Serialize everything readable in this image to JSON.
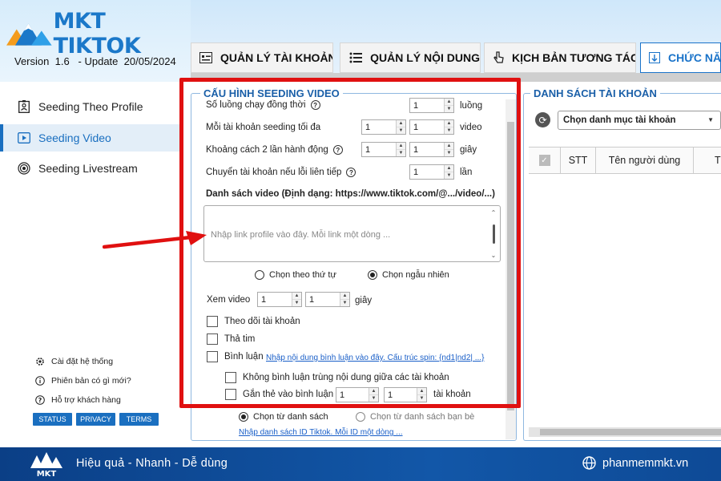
{
  "app": {
    "logo_text": "MKT TIKTOK",
    "version_label": "Version",
    "version": "1.6",
    "update_label": "- Update",
    "update_date": "20/05/2024"
  },
  "tabs": [
    {
      "label": "QUẢN LÝ TÀI KHOẢN",
      "icon": "account-list-icon"
    },
    {
      "label": "QUẢN LÝ NỘI DUNG",
      "icon": "content-list-icon"
    },
    {
      "label": "KỊCH BẢN TƯƠNG TÁC",
      "icon": "hand-pointer-icon"
    },
    {
      "label": "CHỨC NĂ",
      "icon": "function-icon",
      "active": true
    }
  ],
  "sidebar": {
    "items": [
      {
        "label": "Seeding Theo Profile",
        "icon": "profile-card-icon"
      },
      {
        "label": "Seeding Video",
        "icon": "video-icon",
        "active": true
      },
      {
        "label": "Seeding Livestream",
        "icon": "livestream-icon"
      }
    ],
    "footer_links": [
      {
        "label": "Cài đặt hệ thống",
        "icon": "gear-icon"
      },
      {
        "label": "Phiên bản có gì mới?",
        "icon": "info-icon"
      },
      {
        "label": "Hỗ trợ khách hàng",
        "icon": "help-icon"
      }
    ],
    "badges": [
      "STATUS",
      "PRIVACY",
      "TERMS"
    ]
  },
  "config": {
    "title": "CẤU HÌNH SEEDING VIDEO",
    "threads_label": "Số luồng chạy đồng thời",
    "threads_value": "1",
    "threads_unit": "luồng",
    "per_account_label": "Mỗi tài khoản seeding tối đa",
    "per_account_min": "1",
    "per_account_max": "1",
    "per_account_unit": "video",
    "interval_label": "Khoảng cách 2 lần hành động",
    "interval_min": "1",
    "interval_max": "1",
    "interval_unit": "giây",
    "switch_label": "Chuyển tài khoản nếu lỗi liên tiếp",
    "switch_value": "1",
    "switch_unit": "lần",
    "video_list_label": "Danh sách video (Định dạng: https://www.tiktok.com/@.../video/...)",
    "video_list_placeholder": "Nhập link profile vào đây. Mỗi link một dòng ...",
    "order_sequential": "Chọn theo thứ tự",
    "order_random": "Chọn ngẫu nhiên",
    "watch_label": "Xem video",
    "watch_min": "1",
    "watch_max": "1",
    "watch_unit": "giây",
    "follow_label": "Theo dõi tài khoản",
    "like_label": "Thả tim",
    "comment_label": "Bình luận",
    "comment_link": "Nhập nội dung bình luận vào đây. Cấu trúc spin: {nd1|nd2| ...}",
    "no_dup_label": "Không bình luận trùng nội dung giữa các tài khoản",
    "tag_label": "Gắn thẻ vào bình luận",
    "tag_min": "1",
    "tag_max": "1",
    "tag_unit": "tài khoản",
    "from_list": "Chọn từ danh sách",
    "from_friends": "Chọn từ danh sách bạn bè",
    "id_link": "Nhập danh sách ID Tiktok. Mỗi ID một dòng ..."
  },
  "accounts": {
    "title": "DANH SÁCH TÀI KHOẢN",
    "category_select": "Chọn danh mục tài khoản",
    "columns": [
      "STT",
      "Tên người dùng",
      "T"
    ]
  },
  "footer": {
    "logo_text": "MKT",
    "slogan": "Hiệu quả - Nhanh - Dễ dùng",
    "site": "phanmemmkt.vn"
  },
  "colors": {
    "accent": "#1a6fc0",
    "highlight": "#e01010",
    "footer": "#0e4a96"
  }
}
